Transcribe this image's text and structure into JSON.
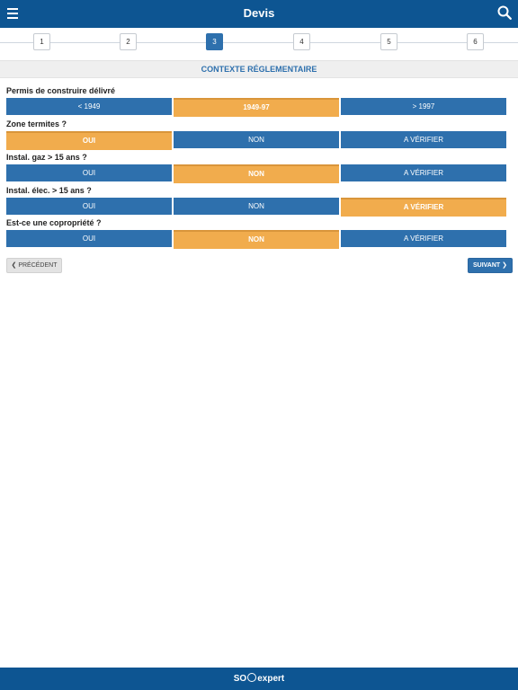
{
  "header": {
    "title": "Devis",
    "menu_icon": "hamburger-menu-icon",
    "search_icon": "search-icon"
  },
  "stepper": {
    "steps": [
      "1",
      "2",
      "3",
      "4",
      "5",
      "6"
    ],
    "active_step": "3"
  },
  "section": {
    "title": "CONTEXTE RÉGLEMENTAIRE"
  },
  "questions": [
    {
      "label": "Permis de construire délivré",
      "options": [
        "< 1949",
        "1949-97",
        "> 1997"
      ],
      "selected": "1949-97"
    },
    {
      "label": "Zone termites ?",
      "options": [
        "OUI",
        "NON",
        "A VÉRIFIER"
      ],
      "selected": "OUI"
    },
    {
      "label": "Instal. gaz > 15 ans ?",
      "options": [
        "OUI",
        "NON",
        "A VÉRIFIER"
      ],
      "selected": "NON"
    },
    {
      "label": "Instal. élec. > 15 ans ?",
      "options": [
        "OUI",
        "NON",
        "A VÉRIFIER"
      ],
      "selected": "A VÉRIFIER"
    },
    {
      "label": "Est-ce une copropriété ?",
      "options": [
        "OUI",
        "NON",
        "A VÉRIFIER"
      ],
      "selected": "NON"
    }
  ],
  "nav": {
    "prev_label": "PRÉCÉDENT",
    "next_label": "SUIVANT",
    "prev_icon": "chevron-left-icon",
    "next_icon": "chevron-right-icon"
  },
  "footer": {
    "logo_left": "SO",
    "logo_right": "expert"
  },
  "colors": {
    "primary": "#0d5592",
    "button": "#2e70ad",
    "selected": "#f1ac4d"
  }
}
